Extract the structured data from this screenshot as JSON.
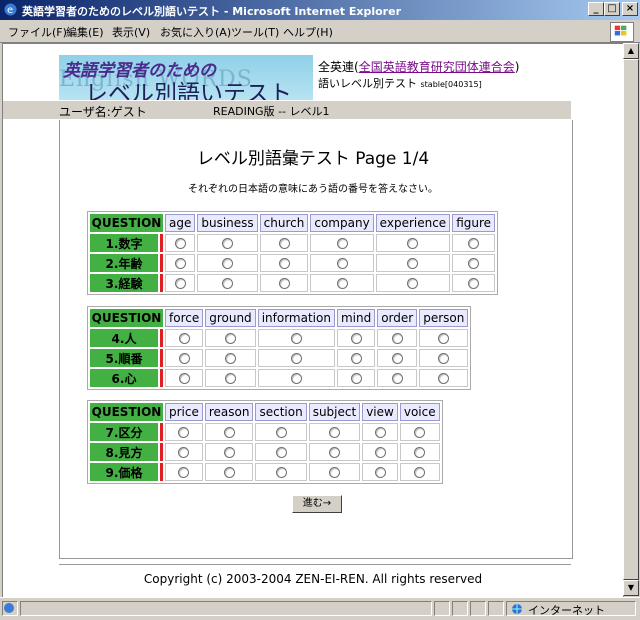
{
  "window": {
    "title": "英語学習者のためのレベル別語いテスト - Microsoft Internet Explorer"
  },
  "menu": [
    "ファイル(F)",
    "編集(E)",
    "表示(V)",
    "お気に入り(A)",
    "ツール(T)",
    "ヘルプ(H)"
  ],
  "header": {
    "logo_line1": "英語学習者のための",
    "logo_line2": "レベル別語いテスト",
    "logo_bg": "English WORDS",
    "org_prefix": "全英連(",
    "org_link": "全国英語教育研究団体連合会",
    "org_suffix": ")",
    "subtitle": "語いレベル別テスト",
    "version": "stable[040315]"
  },
  "userbar": {
    "user": "ユーザ名:ゲスト",
    "mode": "READING版 -- レベル1"
  },
  "page": {
    "title": "レベル別語彙テスト Page 1/4",
    "instruction": "それぞれの日本語の意味にあう語の番号を答えなさい。"
  },
  "groups": [
    {
      "header": "QUESTION",
      "words": [
        "age",
        "business",
        "church",
        "company",
        "experience",
        "figure"
      ],
      "questions": [
        "1.数字",
        "2.年齢",
        "3.経験"
      ]
    },
    {
      "header": "QUESTION",
      "words": [
        "force",
        "ground",
        "information",
        "mind",
        "order",
        "person"
      ],
      "questions": [
        "4.人",
        "5.順番",
        "6.心"
      ]
    },
    {
      "header": "QUESTION",
      "words": [
        "price",
        "reason",
        "section",
        "subject",
        "view",
        "voice"
      ],
      "questions": [
        "7.区分",
        "8.見方",
        "9.価格"
      ]
    }
  ],
  "next_button": "進む→",
  "footer": {
    "copyright": "Copyright (c) 2003-2004 ZEN-EI-REN. All rights reserved"
  },
  "status": {
    "zone": "インターネット"
  }
}
